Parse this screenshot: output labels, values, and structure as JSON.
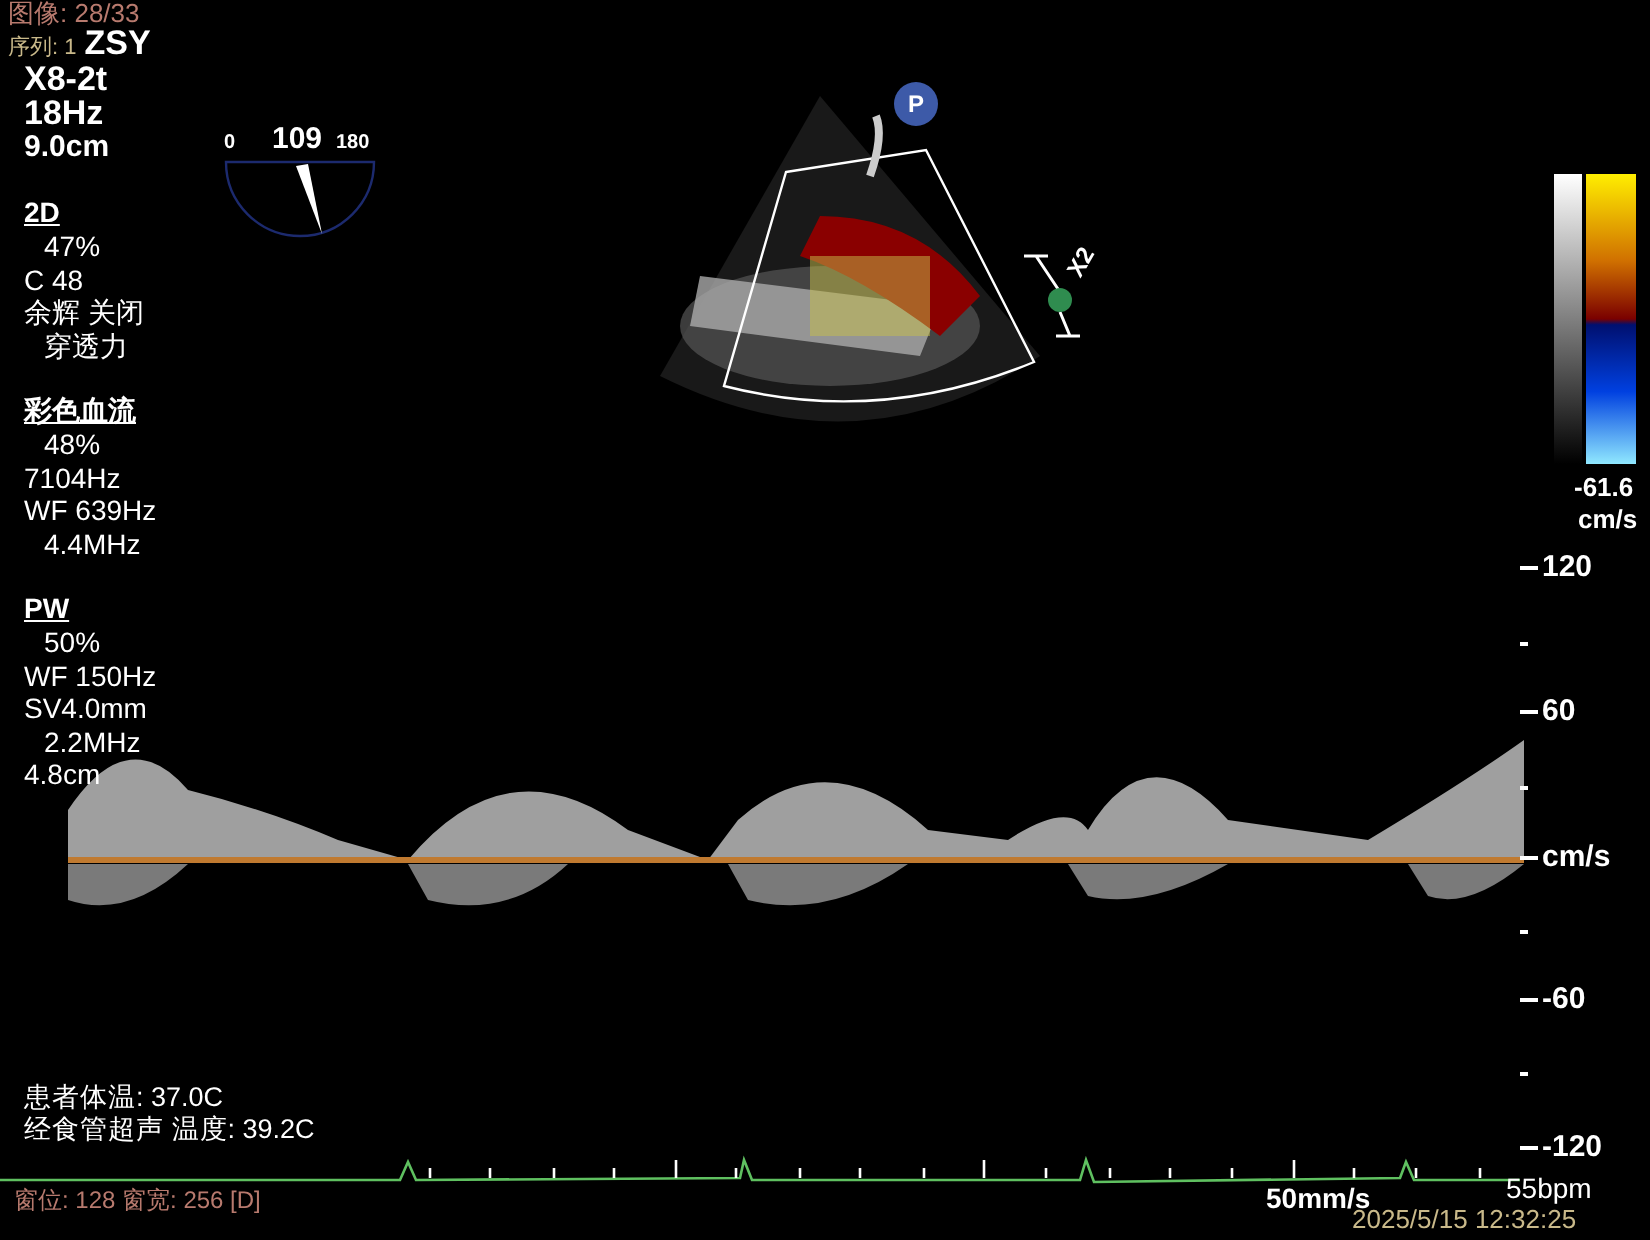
{
  "header": {
    "image_counter": "图像: 28/33",
    "series": "序列: 1",
    "preset": "ZSY"
  },
  "probe": {
    "model": "X8-2t",
    "frame_rate": "18Hz",
    "depth": "9.0cm"
  },
  "angle_dial": {
    "min": "0",
    "value": "109",
    "max": "180"
  },
  "sections": [
    {
      "title": "2D",
      "lines": [
        "47%",
        "C 48",
        "余辉 关闭",
        "穿透力"
      ]
    },
    {
      "title": "彩色血流",
      "lines": [
        "48%",
        "7104Hz",
        "WF 639Hz",
        "4.4MHz"
      ]
    },
    {
      "title": "PW",
      "lines": [
        "50%",
        "WF 150Hz",
        "SV4.0mm",
        "2.2MHz",
        "4.8cm"
      ]
    }
  ],
  "temperatures": [
    "患者体温: 37.0C",
    "经食管超声 温度: 39.2C"
  ],
  "markers": {
    "probe_badge": "P",
    "zoom": "X2"
  },
  "color_scale": {
    "min": "-61.6",
    "unit": "cm/s"
  },
  "velocity_scale": [
    "120",
    "60",
    "cm/s",
    "-60",
    "-120"
  ],
  "footer": {
    "window": "窗位: 128 窗宽: 256 [D]",
    "sweep_speed": "50mm/s",
    "heart_rate": "55bpm",
    "datetime": "2025/5/15 12:32:25"
  }
}
